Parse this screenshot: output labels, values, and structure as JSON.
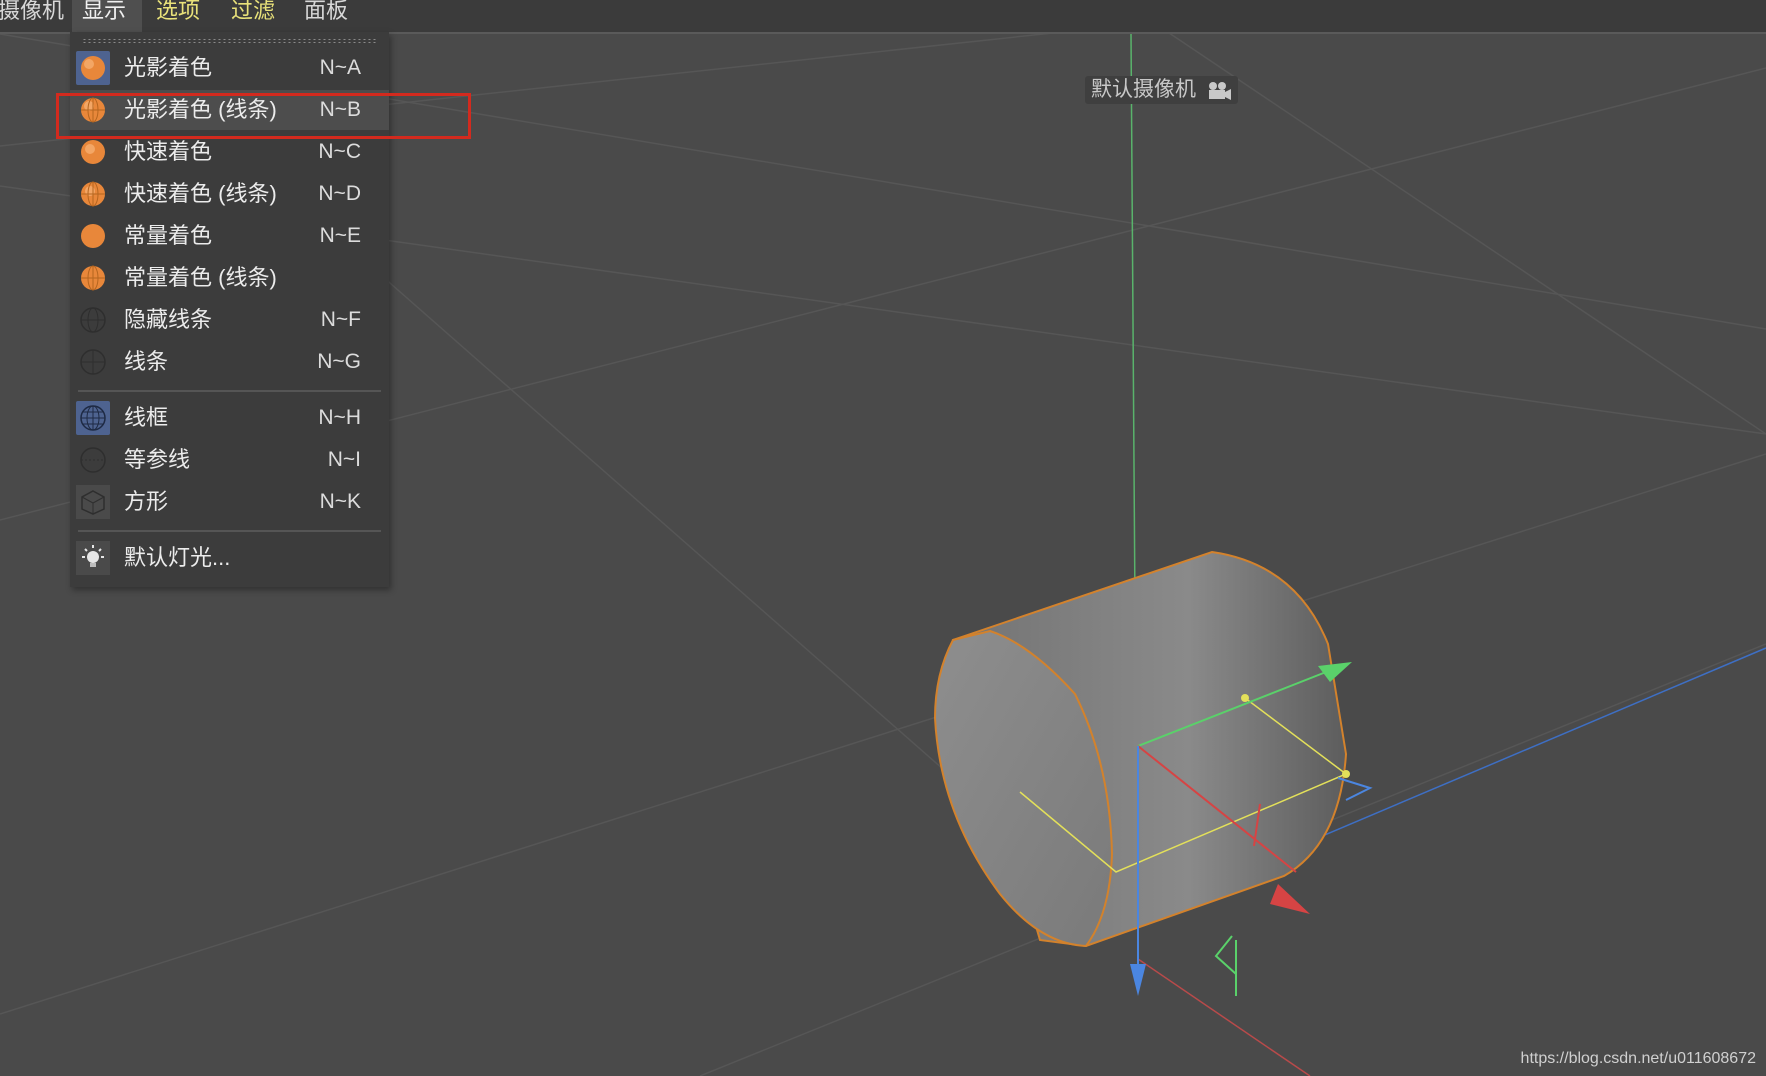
{
  "menubar": {
    "items": [
      {
        "label": "摄像机"
      },
      {
        "label": "显示"
      },
      {
        "label": "选项"
      },
      {
        "label": "过滤"
      },
      {
        "label": "面板"
      }
    ]
  },
  "viewport": {
    "camera_label": "默认摄像机"
  },
  "dropdown": {
    "items": [
      {
        "label": "光影着色",
        "shortcut": "N~A",
        "icon": "orange-sphere-icon"
      },
      {
        "label": "光影着色 (线条)",
        "shortcut": "N~B",
        "icon": "orange-sphere-lines-icon"
      },
      {
        "label": "快速着色",
        "shortcut": "N~C",
        "icon": "orange-sphere-icon"
      },
      {
        "label": "快速着色 (线条)",
        "shortcut": "N~D",
        "icon": "orange-sphere-lines-icon"
      },
      {
        "label": "常量着色",
        "shortcut": "N~E",
        "icon": "orange-flat-sphere-icon"
      },
      {
        "label": "常量着色 (线条)",
        "shortcut": "",
        "icon": "orange-flat-sphere-lines-icon"
      },
      {
        "label": "隐藏线条",
        "shortcut": "N~F",
        "icon": "gray-sphere-lines-icon"
      },
      {
        "label": "线条",
        "shortcut": "N~G",
        "icon": "gray-sphere-lines-icon"
      },
      {
        "label": "线框",
        "shortcut": "N~H",
        "icon": "wireframe-sphere-icon"
      },
      {
        "label": "等参线",
        "shortcut": "N~I",
        "icon": "isoparm-sphere-icon"
      },
      {
        "label": "方形",
        "shortcut": "N~K",
        "icon": "box-icon"
      },
      {
        "label": "默认灯光...",
        "shortcut": "",
        "icon": "light-bulb-icon"
      }
    ]
  },
  "watermark": "https://blog.csdn.net/u011608672",
  "colors": {
    "menu_highlight": "#e9e27a",
    "annotation_box": "#d32a1e",
    "selection_blue": "#4e6390",
    "shade_orange": "#e8873a"
  }
}
